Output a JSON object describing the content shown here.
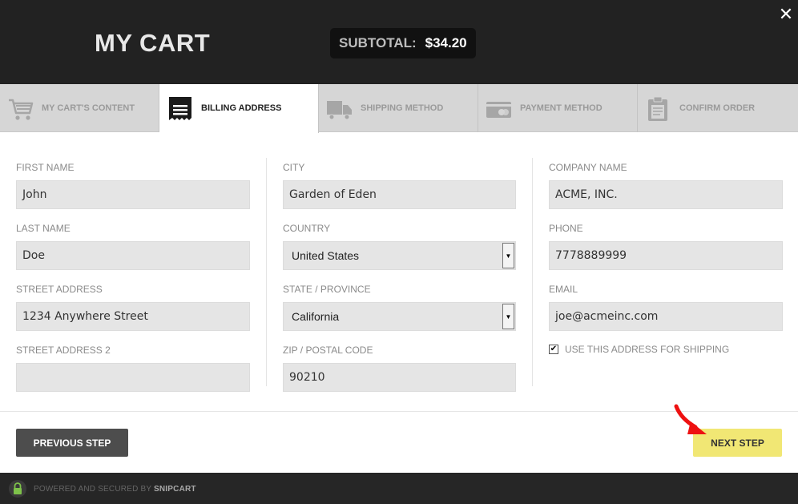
{
  "header": {
    "title": "MY CART",
    "subtotal_label": "SUBTOTAL:",
    "subtotal_value": "$34.20",
    "close_label": "✕"
  },
  "steps": [
    {
      "label": "MY CART'S CONTENT",
      "icon": "cart-icon"
    },
    {
      "label": "BILLING ADDRESS",
      "icon": "receipt-icon",
      "active": true
    },
    {
      "label": "SHIPPING METHOD",
      "icon": "truck-icon"
    },
    {
      "label": "PAYMENT METHOD",
      "icon": "credit-card-icon"
    },
    {
      "label": "CONFIRM ORDER",
      "icon": "clipboard-icon"
    }
  ],
  "form": {
    "first_name": {
      "label": "FIRST NAME",
      "value": "John"
    },
    "last_name": {
      "label": "LAST NAME",
      "value": "Doe"
    },
    "street_address": {
      "label": "STREET ADDRESS",
      "value": "1234 Anywhere Street"
    },
    "street_address_2": {
      "label": "STREET ADDRESS 2",
      "value": ""
    },
    "city": {
      "label": "CITY",
      "value": "Garden of Eden"
    },
    "country": {
      "label": "COUNTRY",
      "value": "United States"
    },
    "state": {
      "label": "STATE / PROVINCE",
      "value": "California"
    },
    "zip": {
      "label": "ZIP / POSTAL CODE",
      "value": "90210"
    },
    "company": {
      "label": "COMPANY NAME",
      "value": "ACME, INC."
    },
    "phone": {
      "label": "PHONE",
      "value": "7778889999"
    },
    "email": {
      "label": "EMAIL",
      "value": "joe@acmeinc.com"
    },
    "use_for_shipping": {
      "label": "USE THIS ADDRESS FOR SHIPPING",
      "checked": true,
      "mark": "✔"
    }
  },
  "buttons": {
    "previous": "PREVIOUS STEP",
    "next": "NEXT STEP"
  },
  "footer": {
    "powered_text": "POWERED AND SECURED BY",
    "brand": "SNIPCART"
  },
  "colors": {
    "header_bg": "#222222",
    "next_button": "#f1e774",
    "prev_button": "#4d4d4d",
    "annotation_arrow": "#ee1111"
  }
}
